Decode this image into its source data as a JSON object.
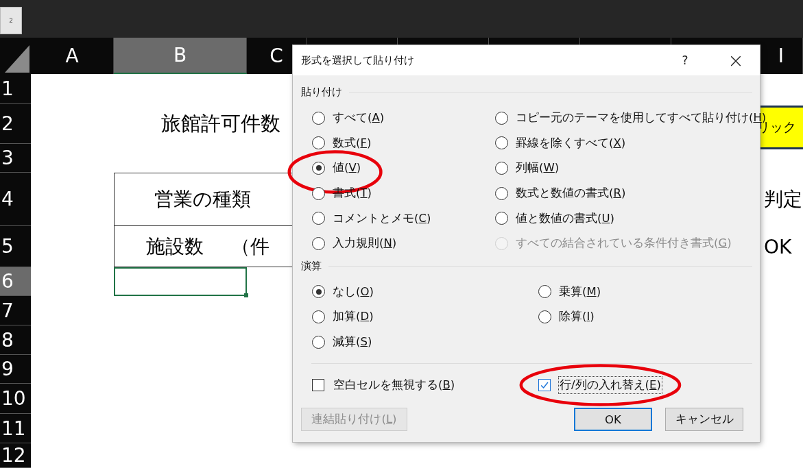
{
  "topbar": {
    "tab": "2"
  },
  "sheet": {
    "columns": [
      {
        "label": "A",
        "selected": false
      },
      {
        "label": "B",
        "selected": true
      },
      {
        "label": "C",
        "selected": false
      },
      {
        "label": "I",
        "selected": false
      }
    ],
    "rows": [
      {
        "label": "1",
        "selected": false
      },
      {
        "label": "2",
        "selected": false
      },
      {
        "label": "3",
        "selected": false
      },
      {
        "label": "4",
        "selected": false
      },
      {
        "label": "5",
        "selected": false
      },
      {
        "label": "6",
        "selected": true
      },
      {
        "label": "7",
        "selected": false
      },
      {
        "label": "8",
        "selected": false
      },
      {
        "label": "9",
        "selected": false
      },
      {
        "label": "10",
        "selected": false
      },
      {
        "label": "11",
        "selected": false
      },
      {
        "label": "12",
        "selected": false
      }
    ],
    "title": "旅館許可件数",
    "table_header": "営業の種類",
    "row_label": "施設数",
    "unit": "（件",
    "yellow_cell": "リック",
    "judgement_header": "判定",
    "judgement_value": "OK"
  },
  "dialog": {
    "title": "形式を選択して貼り付け",
    "help": "?",
    "close": "×",
    "paste_group": "貼り付け",
    "paste_options": [
      {
        "pre": "すべて(",
        "key": "A",
        "post": ")",
        "selected": false,
        "disabled": false,
        "circled": false
      },
      {
        "pre": "コピー元のテーマを使用してすべて貼り付け(",
        "key": "H",
        "post": ")",
        "selected": false,
        "disabled": false,
        "circled": false
      },
      {
        "pre": "数式(",
        "key": "F",
        "post": ")",
        "selected": false,
        "disabled": false,
        "circled": false
      },
      {
        "pre": "罫線を除くすべて(",
        "key": "X",
        "post": ")",
        "selected": false,
        "disabled": false,
        "circled": false
      },
      {
        "pre": "値(",
        "key": "V",
        "post": ")",
        "selected": true,
        "disabled": false,
        "circled": true
      },
      {
        "pre": "列幅(",
        "key": "W",
        "post": ")",
        "selected": false,
        "disabled": false,
        "circled": false
      },
      {
        "pre": "書式(",
        "key": "T",
        "post": ")",
        "selected": false,
        "disabled": false,
        "circled": false
      },
      {
        "pre": "数式と数値の書式(",
        "key": "R",
        "post": ")",
        "selected": false,
        "disabled": false,
        "circled": false
      },
      {
        "pre": "コメントとメモ(",
        "key": "C",
        "post": ")",
        "selected": false,
        "disabled": false,
        "circled": false
      },
      {
        "pre": "値と数値の書式(",
        "key": "U",
        "post": ")",
        "selected": false,
        "disabled": false,
        "circled": false
      },
      {
        "pre": "入力規則(",
        "key": "N",
        "post": ")",
        "selected": false,
        "disabled": false,
        "circled": false
      },
      {
        "pre": "すべての結合されている条件付き書式(",
        "key": "G",
        "post": ")",
        "selected": false,
        "disabled": true,
        "circled": false
      }
    ],
    "operation_group": "演算",
    "operation_options": [
      {
        "pre": "なし(",
        "key": "O",
        "post": ")",
        "selected": true,
        "disabled": false,
        "circled": false
      },
      {
        "pre": "乗算(",
        "key": "M",
        "post": ")",
        "selected": false,
        "disabled": false,
        "circled": false
      },
      {
        "pre": "加算(",
        "key": "D",
        "post": ")",
        "selected": false,
        "disabled": false,
        "circled": false
      },
      {
        "pre": "除算(",
        "key": "I",
        "post": ")",
        "selected": false,
        "disabled": false,
        "circled": false
      },
      {
        "pre": "減算(",
        "key": "S",
        "post": ")",
        "selected": false,
        "disabled": false,
        "circled": false
      }
    ],
    "checkboxes": [
      {
        "pre": "空白セルを無視する(",
        "key": "B",
        "post": ")",
        "checked": false,
        "focused": false,
        "circled": false
      },
      {
        "pre": "行/列の入れ替え(",
        "key": "E",
        "post": ")",
        "checked": true,
        "focused": true,
        "circled": true
      }
    ],
    "buttons": [
      {
        "pre": "連結貼り付け(",
        "key": "L",
        "post": ")",
        "disabled": true,
        "default": false
      },
      {
        "pre": "OK",
        "disabled": false,
        "default": true
      },
      {
        "pre": "キャンセル",
        "disabled": false,
        "default": false
      }
    ]
  }
}
